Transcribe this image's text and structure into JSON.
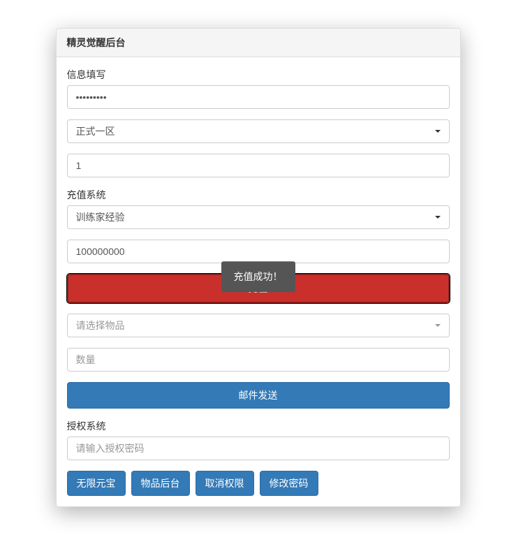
{
  "panel": {
    "title": "精灵觉醒后台"
  },
  "info_section": {
    "label": "信息填写",
    "password_value": "•••••••••",
    "server_selected": "正式一区",
    "id_value": "1"
  },
  "recharge_section": {
    "label": "充值系统",
    "type_selected": "训练家经验",
    "amount_value": "100000000",
    "recharge_button": "充值",
    "item_placeholder": "请选择物品",
    "quantity_placeholder": "数量",
    "mail_send_button": "邮件发送"
  },
  "auth_section": {
    "label": "授权系统",
    "password_placeholder": "请输入授权密码"
  },
  "buttons": {
    "unlimited_gold": "无限元宝",
    "item_admin": "物品后台",
    "revoke_permission": "取消权限",
    "change_password": "修改密码"
  },
  "toast": {
    "message": "充值成功！"
  }
}
